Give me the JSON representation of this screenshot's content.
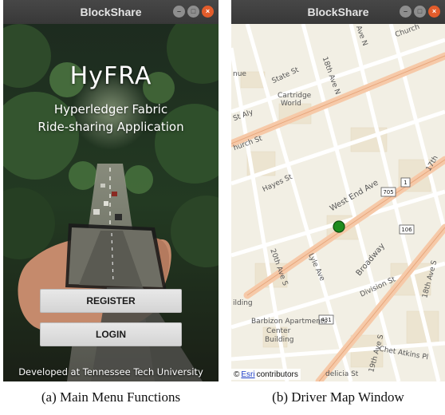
{
  "window_a": {
    "title": "BlockShare",
    "app_title": "HyFRA",
    "subtitle_line1": "Hyperledger Fabric",
    "subtitle_line2": "Ride-sharing Application",
    "register_label": "REGISTER",
    "login_label": "LOGIN",
    "footer": "Developed at Tennessee Tech University"
  },
  "window_b": {
    "title": "BlockShare",
    "map_labels": {
      "church": "Church",
      "ave_n": "Ave N",
      "state_st": "State St",
      "ave_18n": "18th Ave N",
      "cartridge": "Cartridge",
      "world": "World",
      "st_aly": "St Aly",
      "nue": "nue",
      "church_st": "hurch St",
      "hayes_st": "Hayes St",
      "west_end_ave": "West End Ave",
      "broadway": "Broadway",
      "lyle_ave": "Lyle Ave",
      "division_st": "Division St",
      "ave_20s": "20th Ave S",
      "ave_18s": "18th Ave S",
      "building": "ilding",
      "barbizon": "Barbizon Apartments",
      "center": "Center",
      "building2": "Building",
      "chet_atkins": "Chet Atkins Pl",
      "ave_19s": "19th Ave S",
      "ave_17": "17th",
      "delicia": "delicia St",
      "shield_705": "705",
      "shield_1": "1",
      "shield_106": "106",
      "shield_431": "431"
    },
    "attribution_prefix": "©",
    "attribution_link": "Esri",
    "attribution_suffix": "contributors"
  },
  "captions": {
    "a": "(a) Main Menu Functions",
    "b": "(b) Driver Map Window"
  },
  "colors": {
    "titlebar": "#3c3c3c",
    "close_button": "#e35c2b",
    "map_bg": "#f2efe4",
    "block": "#ece4d0",
    "major_road": "#f6c9a8",
    "driver_marker": "#1e8c1e"
  }
}
